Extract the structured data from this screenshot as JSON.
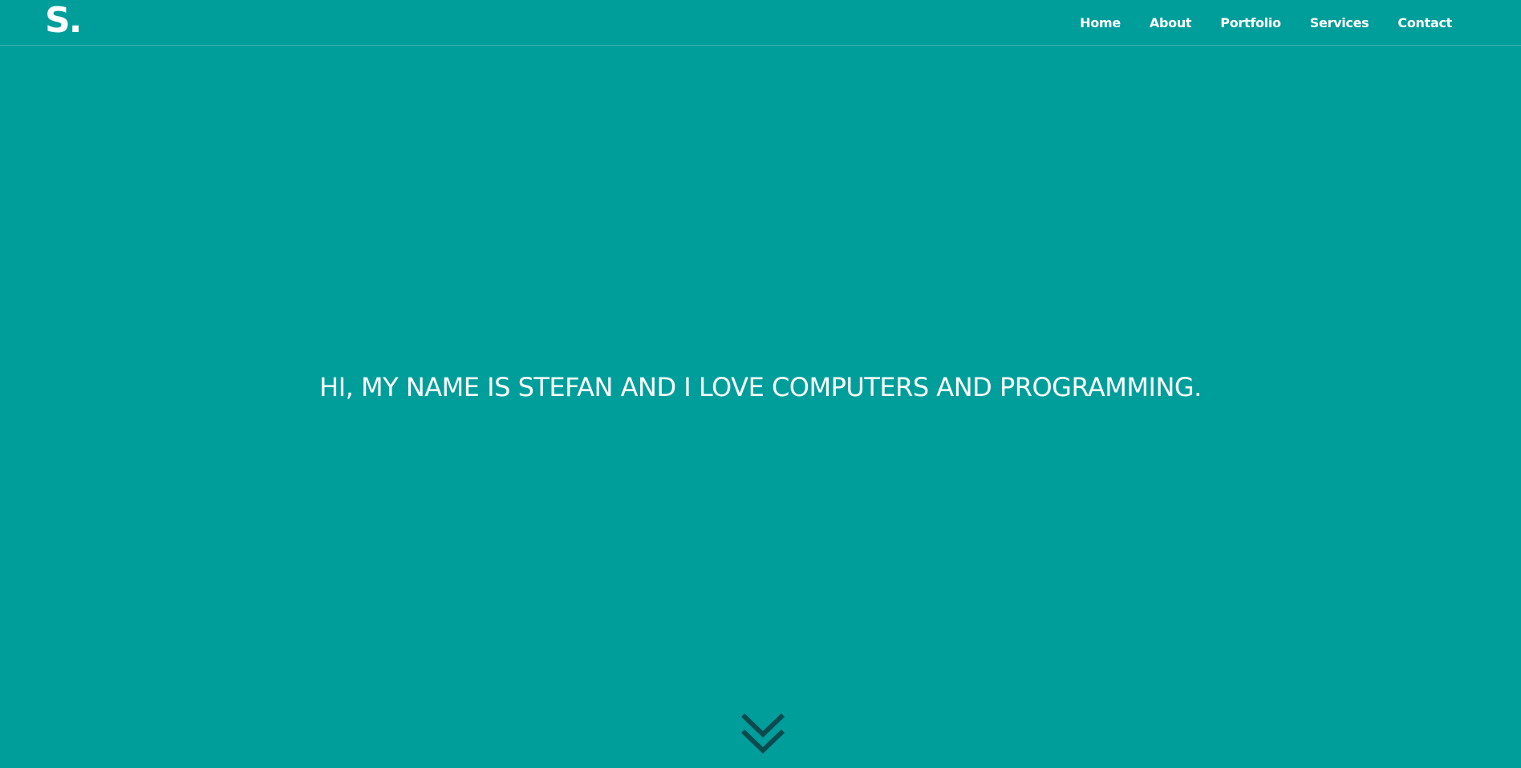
{
  "header": {
    "logo_text": "S.",
    "nav": [
      {
        "label": "Home"
      },
      {
        "label": "About"
      },
      {
        "label": "Portfolio"
      },
      {
        "label": "Services"
      },
      {
        "label": "Contact"
      }
    ]
  },
  "hero": {
    "title": "HI, MY NAME IS STEFAN AND I LOVE COMPUTERS AND PROGRAMMING."
  },
  "icons": {
    "scroll": "double-chevron-down-icon"
  },
  "colors": {
    "background": "#009e9b",
    "text": "#ffffff",
    "scroll_icon": "#0b4a4e"
  }
}
